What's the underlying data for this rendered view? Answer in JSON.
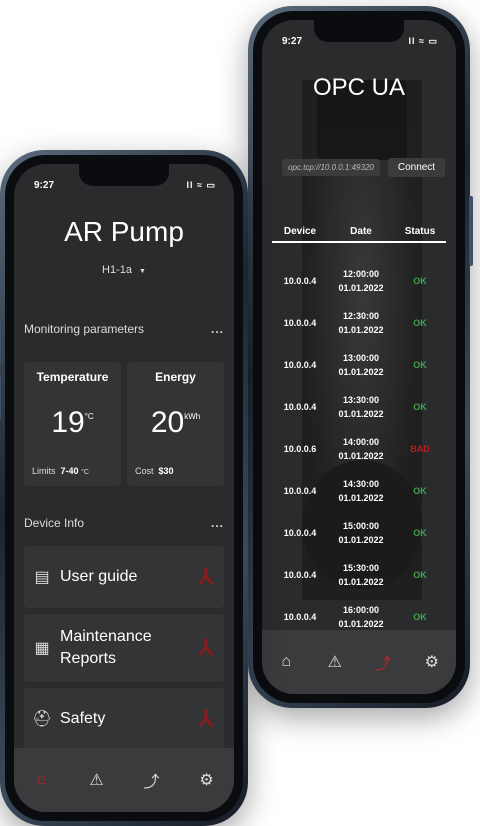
{
  "back_phone": {
    "status": {
      "time": "9:27",
      "signal": "Il ≈ ▭"
    },
    "title": "OPC UA",
    "connection": {
      "address": "opc.tcp://10.0.0.1:49320",
      "button": "Connect"
    },
    "table": {
      "headers": [
        "Device",
        "Date",
        "Status"
      ],
      "rows": [
        {
          "device": "10.0.0.4",
          "time": "12:00:00",
          "date": "01.01.2022",
          "status": "OK"
        },
        {
          "device": "10.0.0.4",
          "time": "12:30:00",
          "date": "01.01.2022",
          "status": "OK"
        },
        {
          "device": "10.0.0.4",
          "time": "13:00:00",
          "date": "01.01.2022",
          "status": "OK"
        },
        {
          "device": "10.0.0.4",
          "time": "13:30:00",
          "date": "01.01.2022",
          "status": "OK"
        },
        {
          "device": "10.0.0.6",
          "time": "14:00:00",
          "date": "01.01.2022",
          "status": "BAD"
        },
        {
          "device": "10.0.0.4",
          "time": "14:30:00",
          "date": "01.01.2022",
          "status": "OK"
        },
        {
          "device": "10.0.0.4",
          "time": "15:00:00",
          "date": "01.01.2022",
          "status": "OK"
        },
        {
          "device": "10.0.0.4",
          "time": "15:30:00",
          "date": "01.01.2022",
          "status": "OK"
        },
        {
          "device": "10.0.0.4",
          "time": "16:00:00",
          "date": "01.01.2022",
          "status": "OK"
        }
      ]
    },
    "tabs": [
      {
        "icon": "home-icon",
        "glyph": "⌂",
        "active": false
      },
      {
        "icon": "network-icon",
        "glyph": "⚠",
        "active": false
      },
      {
        "icon": "graph-icon",
        "glyph": "⤴",
        "active": true
      },
      {
        "icon": "gear-icon",
        "glyph": "⚙",
        "active": false
      }
    ]
  },
  "left_phone": {
    "status": {
      "time": "9:27",
      "signal": "Il ≈ ▭"
    },
    "title": "AR Pump",
    "device_selector": "H1-1a",
    "monitoring": {
      "heading": "Monitoring parameters",
      "more": "...",
      "temperature": {
        "title": "Temperature",
        "value": "19",
        "unit": "°C",
        "limits_label": "Limits",
        "limits_value": "7-40",
        "limits_unit": "°C"
      },
      "energy": {
        "title": "Energy",
        "value": "20",
        "unit": "kWh",
        "cost_label": "Cost",
        "cost_value": "$30"
      }
    },
    "device_info": {
      "heading": "Device Info",
      "more": "...",
      "items": [
        {
          "label": "User guide",
          "icon": "book-icon"
        },
        {
          "label": "Maintenance Reports",
          "icon": "report-icon"
        },
        {
          "label": "Safety",
          "icon": "helmet-icon"
        }
      ]
    },
    "tabs": [
      {
        "icon": "home-icon",
        "glyph": "⌂",
        "active": true
      },
      {
        "icon": "network-icon",
        "glyph": "⚠",
        "active": false
      },
      {
        "icon": "graph-icon",
        "glyph": "⤴",
        "active": false
      },
      {
        "icon": "gear-icon",
        "glyph": "⚙",
        "active": false
      }
    ]
  },
  "colors": {
    "ok": "#3fa34d",
    "bad": "#b81e1e",
    "accent": "#c0242a"
  }
}
